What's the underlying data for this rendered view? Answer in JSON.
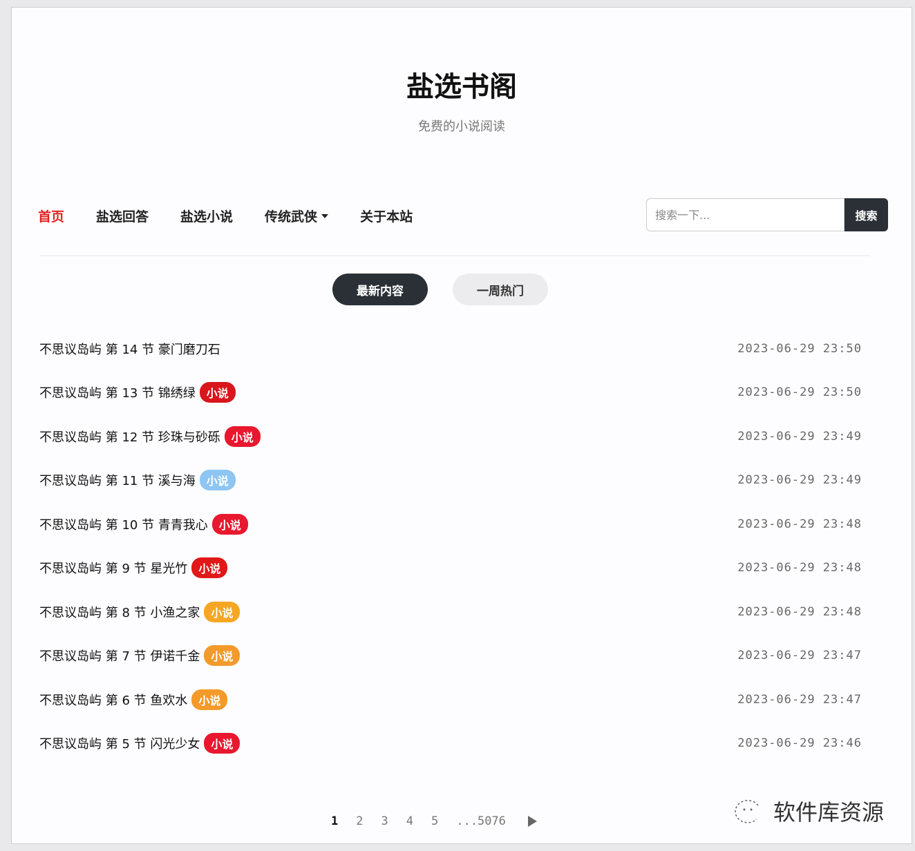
{
  "header": {
    "title": "盐选书阁",
    "subtitle": "免费的小说阅读"
  },
  "nav": {
    "items": [
      {
        "label": "首页",
        "active": true
      },
      {
        "label": "盐选回答"
      },
      {
        "label": "盐选小说"
      },
      {
        "label": "传统武侠",
        "dropdown": true
      },
      {
        "label": "关于本站"
      }
    ]
  },
  "search": {
    "placeholder": "搜索一下...",
    "button": "搜索"
  },
  "tabs": [
    {
      "label": "最新内容",
      "active": true
    },
    {
      "label": "一周热门"
    }
  ],
  "items": [
    {
      "title": "不思议岛屿 第 14 节 豪门磨刀石",
      "badge": null,
      "badge_color": null,
      "date": "2023-06-29 23:50"
    },
    {
      "title": "不思议岛屿 第 13 节 锦绣绿",
      "badge": "小说",
      "badge_color": "#d8161c",
      "date": "2023-06-29 23:50"
    },
    {
      "title": "不思议岛屿 第 12 节 珍珠与砂砾",
      "badge": "小说",
      "badge_color": "#e8182e",
      "date": "2023-06-29 23:49"
    },
    {
      "title": "不思议岛屿 第 11 节 溪与海",
      "badge": "小说",
      "badge_color": "#8ec5f2",
      "date": "2023-06-29 23:49"
    },
    {
      "title": "不思议岛屿 第 10 节 青青我心",
      "badge": "小说",
      "badge_color": "#e8182e",
      "date": "2023-06-29 23:48"
    },
    {
      "title": "不思议岛屿 第 9 节 星光竹",
      "badge": "小说",
      "badge_color": "#e01818",
      "date": "2023-06-29 23:48"
    },
    {
      "title": "不思议岛屿 第 8 节 小渔之家",
      "badge": "小说",
      "badge_color": "#f5a623",
      "date": "2023-06-29 23:48"
    },
    {
      "title": "不思议岛屿 第 7 节 伊诺千金",
      "badge": "小说",
      "badge_color": "#f39a2b",
      "date": "2023-06-29 23:47"
    },
    {
      "title": "不思议岛屿 第 6 节 鱼欢水",
      "badge": "小说",
      "badge_color": "#f39a2b",
      "date": "2023-06-29 23:47"
    },
    {
      "title": "不思议岛屿 第 5 节 闪光少女",
      "badge": "小说",
      "badge_color": "#e8182e",
      "date": "2023-06-29 23:46"
    }
  ],
  "pagination": {
    "pages": [
      "1",
      "2",
      "3",
      "4",
      "5"
    ],
    "last": "...5076",
    "current": "1"
  },
  "watermark": "软件库资源"
}
